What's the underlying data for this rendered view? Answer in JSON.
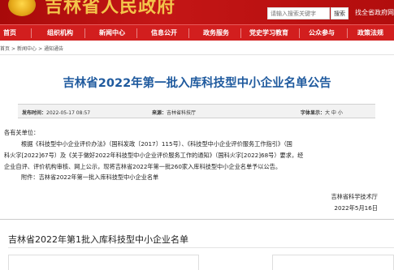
{
  "header": {
    "site_title": "吉林省人民政府",
    "search_placeholder": "请输入搜索关键字",
    "search_button": "搜索",
    "header_link": "找全省政府网站"
  },
  "nav": {
    "items": [
      "首页",
      "组织机构",
      "新闻中心",
      "信息公开",
      "政务服务",
      "党史学习教育",
      "公众参与",
      "政策法规"
    ]
  },
  "breadcrumb": {
    "items": [
      "首页",
      ">",
      "新闻中心",
      ">",
      "通知通告"
    ]
  },
  "article": {
    "title": "吉林省2022年第一批入库科技型中小企业名单公告",
    "meta": {
      "date_label": "发布时间：",
      "date_value": "2022-05-17 08:57",
      "source_label": "来源：",
      "source_value": "吉林省科技厅",
      "font_label": "字体显示：",
      "font_options": "大 中 小"
    },
    "salutation": "各有关单位：",
    "paragraph_lines": [
      "根据《科技型中小企业评价办法》（国科发政〔2017〕115号）、《科技型中小企业评价服务工作指引》（国",
      "科火字[2022]67号）及《关于做好2022年科技型中小企业评价服务工作的通知》（国科火字[2022]68号）要求，经",
      "企业自评、评价机构审核、网上公示，现将吉林省2022年第一批260家入库科技型中小企业名单予以公告。"
    ],
    "attachment": "附件：吉林省2022年第一批入库科技型中小企业名单",
    "signature": "吉林省科学技术厅",
    "signature_date": "2022年5月16日"
  },
  "attachment_section": {
    "title": "吉林省2022年第1批入库科技型中小企业名单"
  },
  "colors": {
    "header_red": "#b30f0f",
    "nav_red": "#d21e1e",
    "title_blue": "#1f5a9e",
    "site_title_gold": "#f3c44a"
  }
}
